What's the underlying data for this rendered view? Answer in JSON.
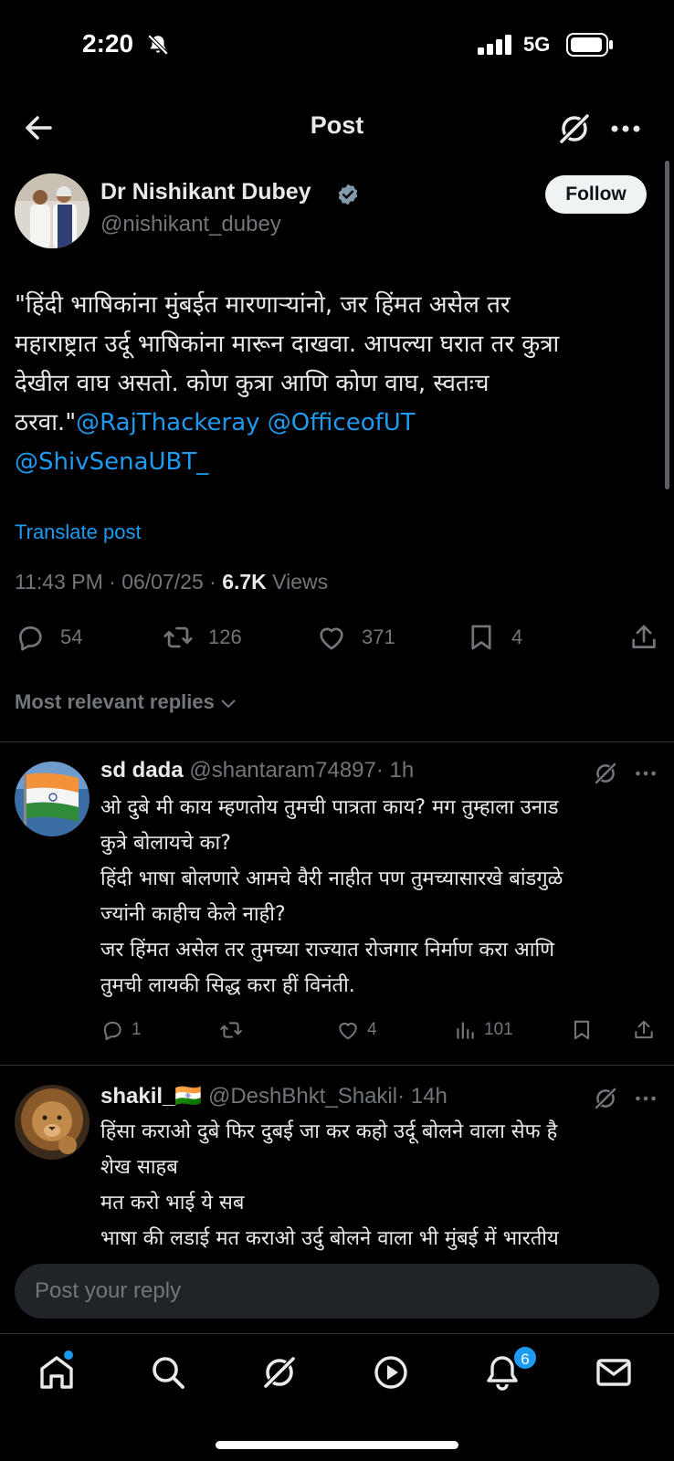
{
  "status_bar": {
    "time": "2:20",
    "network": "5G"
  },
  "header": {
    "title": "Post"
  },
  "post": {
    "author_name": "Dr Nishikant Dubey",
    "author_handle": "@nishikant_dubey",
    "follow_label": "Follow",
    "text_lines": [
      "\"हिंदी भाषिकांना मुंबईत मारणाऱ्यांनो, जर हिंमत असेल तर",
      "महाराष्ट्रात उर्दू भाषिकांना मारून दाखवा. आपल्या घरात तर कुत्रा",
      "देखील वाघ असतो. कोण कुत्रा आणि कोण वाघ, स्वतःच",
      "ठरवा.\""
    ],
    "mentions": [
      "@RajThackeray",
      "@OfficeofUT",
      "@ShivSenaUBT_"
    ],
    "translate_label": "Translate post",
    "time": "11:43 PM",
    "date": "06/07/25",
    "views_count": "6.7K",
    "views_label": "Views",
    "replies": "54",
    "reposts": "126",
    "likes": "371",
    "bookmarks": "4"
  },
  "replies_sort_label": "Most relevant replies",
  "replies": [
    {
      "name": "sd dada",
      "handle": "@shantaram74897",
      "time": "· 1h",
      "lines": [
        "ओ दुबे मी काय म्हणतोय तुमची पात्रता काय? मग तुम्हाला उनाड",
        "कुत्रे बोलायचे का?",
        "हिंदी भाषा बोलणारे आमचे वैरी नाहीत पण तुमच्यासारखे बांडगुळे",
        "ज्यांनी काहीच केले नाही?",
        "जर हिंमत असेल तर तुमच्या राज्यात रोजगार निर्माण करा आणि",
        "तुमची लायकी सिद्ध करा हीं विनंती."
      ],
      "replies": "1",
      "likes": "4",
      "views": "101"
    },
    {
      "name": "shakil_🇮🇳",
      "handle": "@DeshBhkt_Shakil",
      "time": "· 14h",
      "lines": [
        "हिंसा कराओ दुबे फिर दुबई जा कर कहो उर्दू बोलने वाला सेफ है",
        "शेख साहब",
        "मत करो भाई ये सब",
        "भाषा की लडाई मत कराओ उर्दु बोलने वाला भी मुंबई में भारतीय"
      ]
    }
  ],
  "reply_bar": {
    "placeholder": "Post your reply"
  },
  "tabbar": {
    "notifications_badge": "6"
  },
  "colors": {
    "accent": "#1d9bf0",
    "background": "#000000",
    "muted": "#71767b"
  }
}
